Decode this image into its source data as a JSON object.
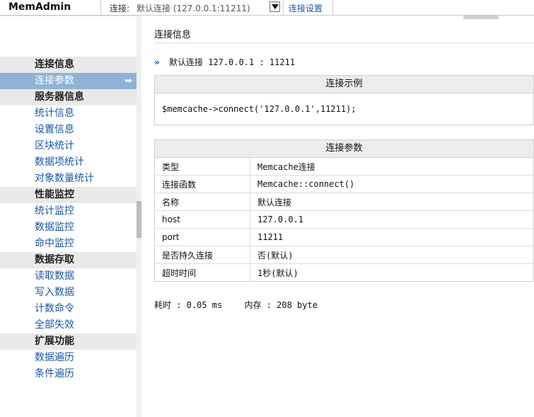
{
  "header": {
    "app_title": "MemAdmin",
    "connection_label": "连接:",
    "connection_value": "默认连接 (127.0.0.1:11211)",
    "settings_link": "连接设置"
  },
  "sidebar": {
    "groups": [
      {
        "title": "连接信息",
        "items": [
          {
            "label": "连接参数",
            "active": true
          }
        ]
      },
      {
        "title": "服务器信息",
        "items": [
          {
            "label": "统计信息"
          },
          {
            "label": "设置信息"
          },
          {
            "label": "区块统计"
          },
          {
            "label": "数据项统计"
          },
          {
            "label": "对象数量统计"
          }
        ]
      },
      {
        "title": "性能监控",
        "items": [
          {
            "label": "统计监控"
          },
          {
            "label": "数据监控"
          },
          {
            "label": "命中监控"
          }
        ]
      },
      {
        "title": "数据存取",
        "items": [
          {
            "label": "读取数据"
          },
          {
            "label": "写入数据"
          },
          {
            "label": "计数命令"
          },
          {
            "label": "全部失效"
          }
        ]
      },
      {
        "title": "扩展功能",
        "items": [
          {
            "label": "数据遍历"
          },
          {
            "label": "条件遍历"
          }
        ]
      }
    ]
  },
  "main": {
    "title": "连接信息",
    "connection_summary": "默认连接 127.0.0.1 : 11211",
    "example": {
      "header": "连接示例",
      "code": "$memcache->connect('127.0.0.1',11211);"
    },
    "params": {
      "header": "连接参数",
      "rows": [
        {
          "key": "类型",
          "value": "Memcache连接"
        },
        {
          "key": "连接函数",
          "value": "Memcache::connect()"
        },
        {
          "key": "名称",
          "value": "默认连接"
        },
        {
          "key": "host",
          "value": "127.0.0.1"
        },
        {
          "key": "port",
          "value": "11211"
        },
        {
          "key": "是否持久连接",
          "value": "否(默认)"
        },
        {
          "key": "超时时间",
          "value": "1秒(默认)"
        }
      ]
    },
    "stats": {
      "time": "耗时 : 0.05 ms",
      "memory": "内存 : 208 byte"
    }
  }
}
